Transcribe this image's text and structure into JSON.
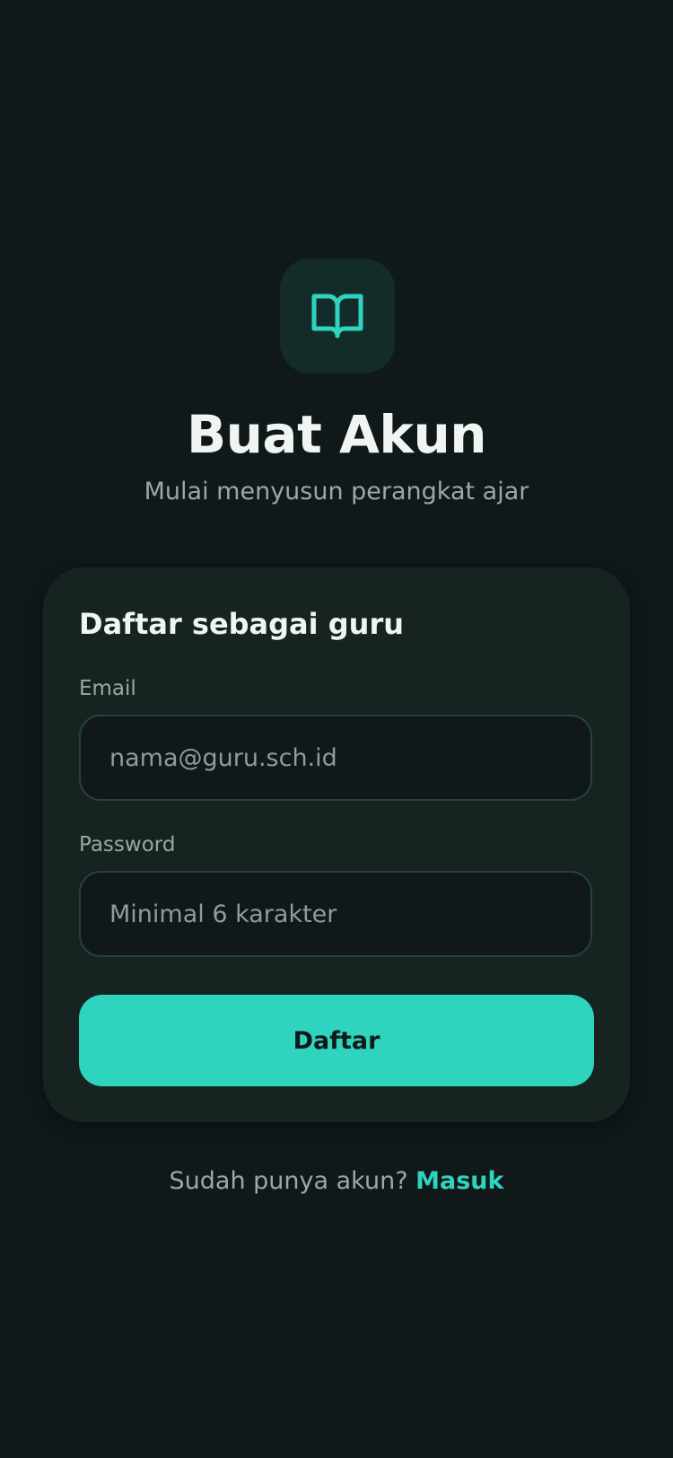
{
  "header": {
    "icon": "book-open-icon",
    "title": "Buat Akun",
    "subtitle": "Mulai menyusun perangkat ajar"
  },
  "form": {
    "title": "Daftar sebagai guru",
    "email": {
      "label": "Email",
      "value": "",
      "placeholder": "nama@guru.sch.id"
    },
    "password": {
      "label": "Password",
      "value": "",
      "placeholder": "Minimal 6 karakter"
    },
    "submit_label": "Daftar"
  },
  "footer": {
    "prompt": "Sudah punya akun?",
    "link_label": "Masuk"
  },
  "colors": {
    "background": "#101819",
    "card": "#172321",
    "accent": "#2fd4bf",
    "icon_tile": "#142c29",
    "muted_text": "#9aa9a5"
  }
}
